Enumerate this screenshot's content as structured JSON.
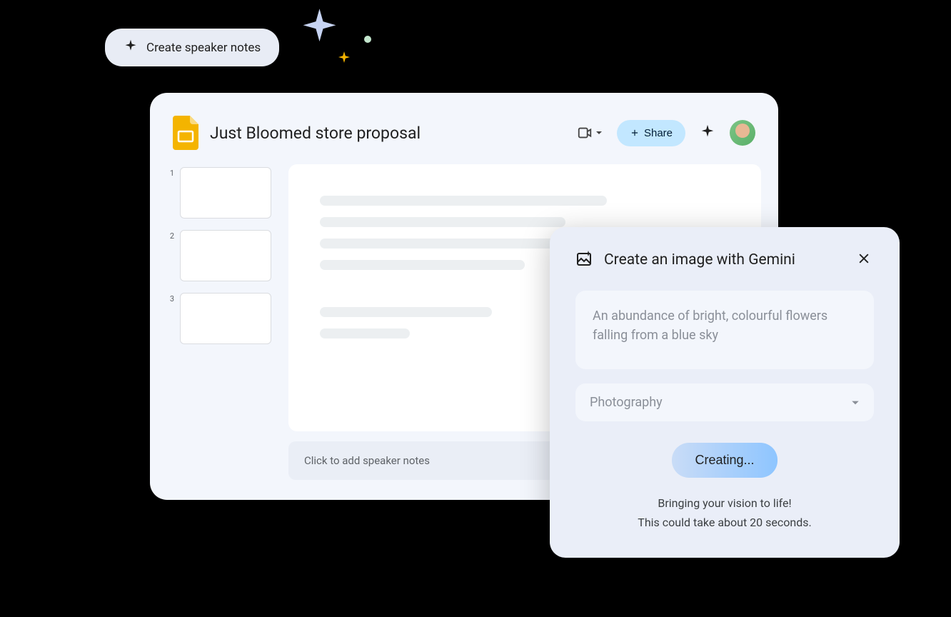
{
  "chip": {
    "label": "Create speaker notes"
  },
  "doc": {
    "title": "Just Bloomed store proposal",
    "share_label": "Share",
    "speaker_notes_placeholder": "Click to add speaker notes"
  },
  "thumbs": [
    {
      "num": "1"
    },
    {
      "num": "2"
    },
    {
      "num": "3"
    }
  ],
  "gemini": {
    "title": "Create an image with Gemini",
    "prompt": "An abundance of bright, colourful flowers falling from a blue sky",
    "style": "Photography",
    "creating_label": "Creating...",
    "status_line1": "Bringing your vision to life!",
    "status_line2": "This could take about 20 seconds."
  }
}
